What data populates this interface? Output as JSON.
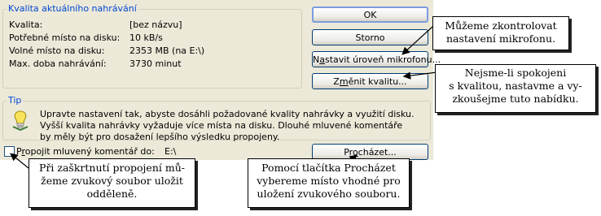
{
  "quality_group": {
    "title": "Kvalita aktuálního nahrávání",
    "rows": [
      {
        "label": "Kvalita:",
        "value": "[bez názvu]"
      },
      {
        "label": "Potřebné místo na disku:",
        "value": "10 kB/s"
      },
      {
        "label": "Volné místo na disku:",
        "value": "2353 MB (na E:\\)"
      },
      {
        "label": "Max. doba nahrávání:",
        "value": "3730 minut"
      }
    ]
  },
  "buttons": {
    "ok": "OK",
    "cancel": "Storno",
    "mic_pre": "N",
    "mic_u": "a",
    "mic_post": "stavit úroveň mikrofonu...",
    "quality_pre": "Z",
    "quality_u": "m",
    "quality_post": "ěnit kvalitu...",
    "browse_pre": "Pr",
    "browse_u": "o",
    "browse_post": "cházet..."
  },
  "tip": {
    "title": "Tip",
    "text": "Upravte nastavení tak, abyste dosáhli požadované kvality nahrávky a využití disku. Vyšší kvalita nahrávky vyžaduje více místa na disku. Dlouhé mluvené komentáře by měly být pro dosažení lepšího výsledku propojeny.",
    "icon": "lightbulb-icon"
  },
  "link_option": {
    "label_pre": "P",
    "label_u": "r",
    "label_post": "opojit mluvený komentář do:",
    "path": "E:\\",
    "checked": false
  },
  "callouts": {
    "mic": "Můžeme zkontrolovat nastavení mikrofonu.",
    "quality_line1": "Nejsme-li spokojeni",
    "quality_line2": "s kvalitou, nastavme a vy-",
    "quality_line3": "zkoušejme tuto nabídku.",
    "checkbox_line1": "Při zaškrtnutí propojení mů-",
    "checkbox_line2": "žeme zvukový soubor uložit",
    "checkbox_line3": "odděleně.",
    "browse_line1": "Pomocí tlačítka Procházet",
    "browse_line2": "vybereme místo vhodné pro",
    "browse_line3": "uložení zvukového souboru."
  },
  "colors": {
    "dialog_bg": "#ece9d8",
    "group_title": "#0046d5",
    "button_border": "#003c74"
  }
}
